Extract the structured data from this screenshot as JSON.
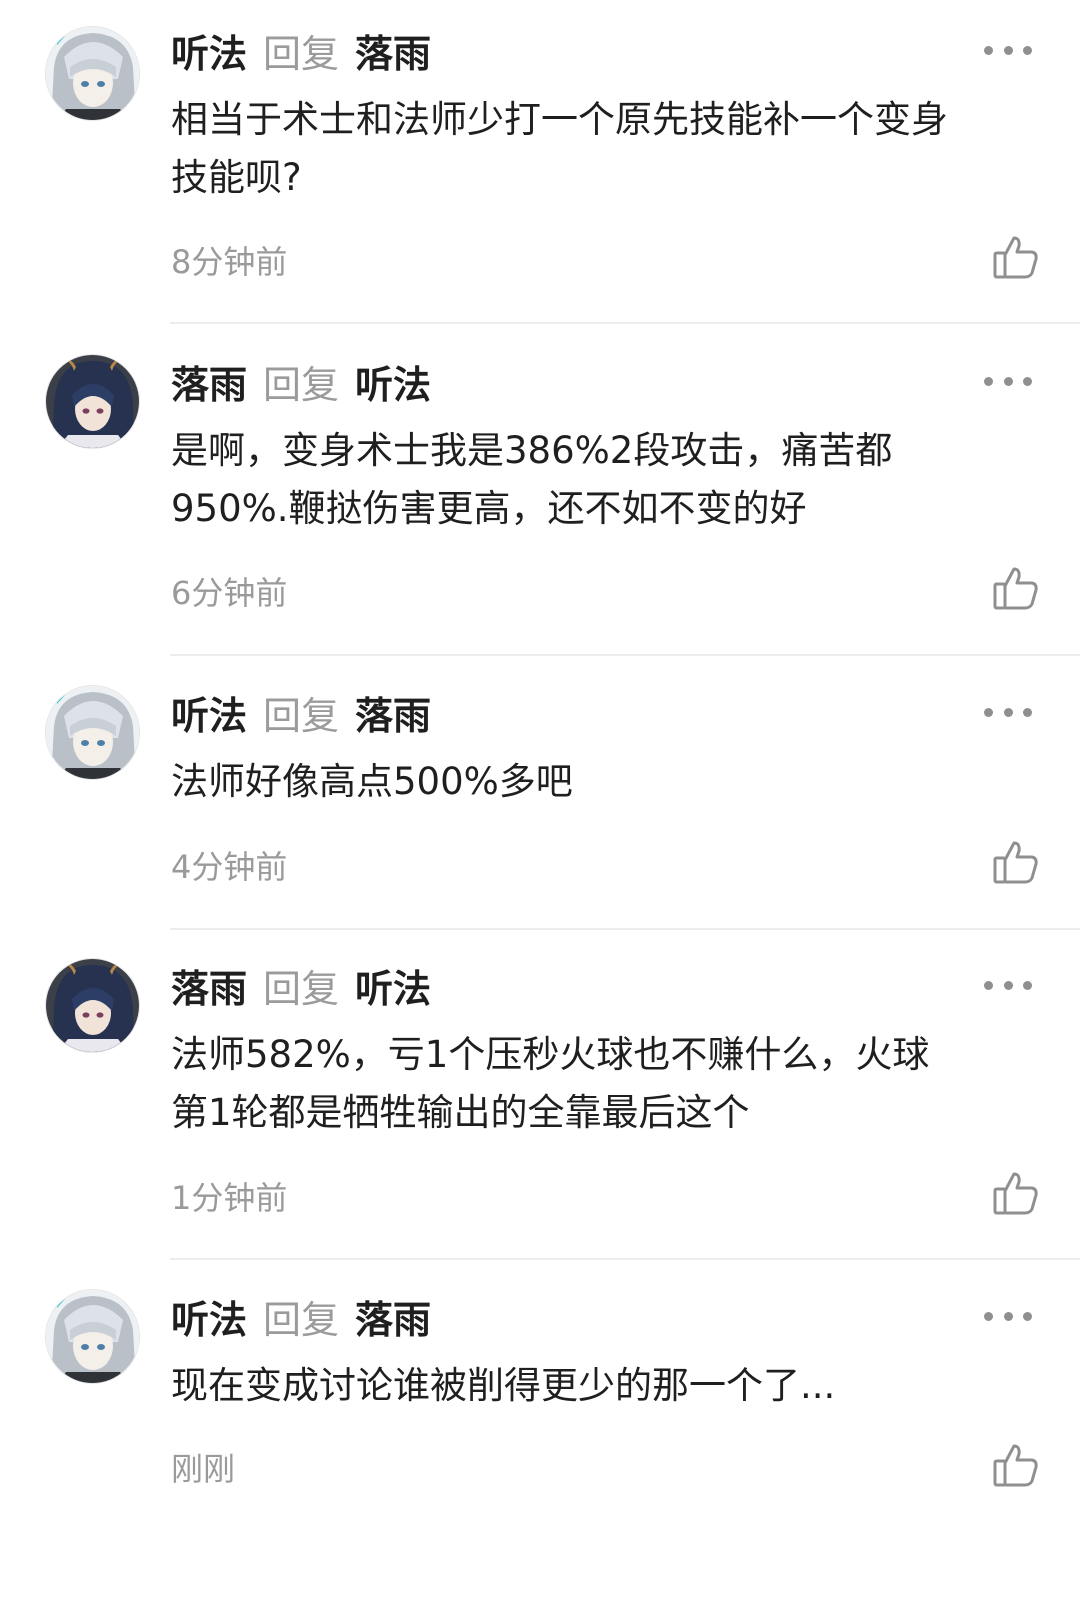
{
  "comments": [
    {
      "author": "听法",
      "reply_word": "回复",
      "reply_to": "落雨",
      "avatar_icon": "silver-hair-avatar",
      "text": "相当于术士和法师少打一个原先技能补一个变身\n技能呗?",
      "time": "8分钟前"
    },
    {
      "author": "落雨",
      "reply_word": "回复",
      "reply_to": "听法",
      "avatar_icon": "dark-blue-hair-avatar",
      "text": "是啊，变身术士我是386%2段攻击，痛苦都\n950%.鞭挞伤害更高，还不如不变的好",
      "time": "6分钟前"
    },
    {
      "author": "听法",
      "reply_word": "回复",
      "reply_to": "落雨",
      "avatar_icon": "silver-hair-avatar",
      "text": "法师好像高点500%多吧",
      "time": "4分钟前"
    },
    {
      "author": "落雨",
      "reply_word": "回复",
      "reply_to": "听法",
      "avatar_icon": "dark-blue-hair-avatar",
      "text": "法师582%，亏1个压秒火球也不赚什么，火球\n第1轮都是牺牲输出的全靠最后这个",
      "time": "1分钟前"
    },
    {
      "author": "听法",
      "reply_word": "回复",
      "reply_to": "落雨",
      "avatar_icon": "silver-hair-avatar",
      "text": "现在变成讨论谁被削得更少的那一个了...",
      "time": "刚刚"
    }
  ],
  "icons": {
    "more": "more-dots-icon",
    "like": "thumbs-up-icon"
  },
  "colors": {
    "name": "#1f1f1f",
    "reply_word": "#9b9b9b",
    "time": "#9a9a9a",
    "divider": "#ececec",
    "icon": "#8f8f8f"
  }
}
